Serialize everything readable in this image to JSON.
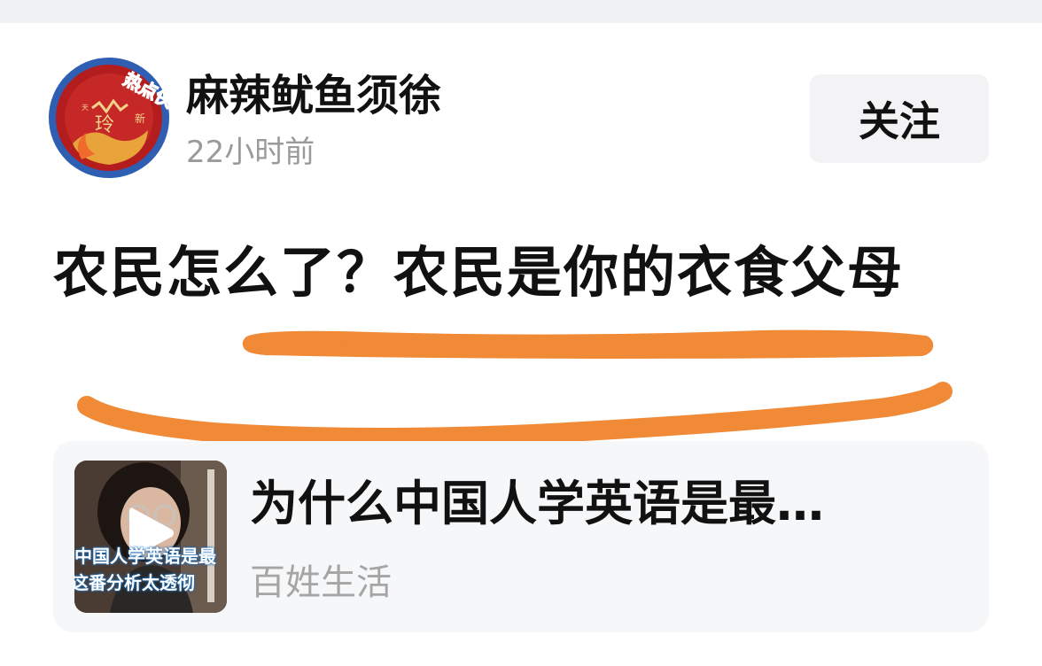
{
  "author": {
    "name": "麻辣鱿鱼须徐",
    "time": "22小时前",
    "badge_text": "热点侠"
  },
  "follow_label": "关注",
  "post": {
    "text": "农民怎么了？农民是你的衣食父母"
  },
  "card": {
    "title": "为什么中国人学英语是最…",
    "source": "百姓生活",
    "thumb_caption_line1": "中国人学英语是最",
    "thumb_caption_line2": "这番分析太透彻"
  },
  "colors": {
    "scribble": "#f08a36",
    "text": "#111111",
    "muted": "#9a9a9a",
    "card_bg": "#f6f7f9"
  },
  "icons": {
    "avatar": "author-avatar",
    "play": "play-icon"
  }
}
